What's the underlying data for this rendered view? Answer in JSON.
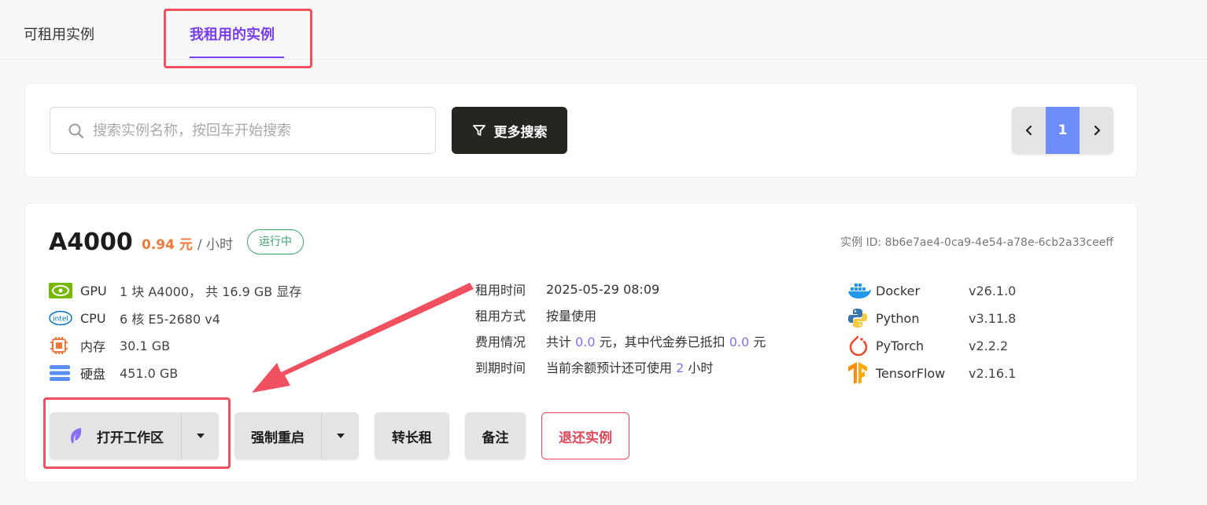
{
  "tabs": [
    {
      "label": "可租用实例",
      "active": false
    },
    {
      "label": "我租用的实例",
      "active": true
    }
  ],
  "search": {
    "placeholder": "搜索实例名称，按回车开始搜索",
    "value": "",
    "more_label": "更多搜索"
  },
  "pagination": {
    "prev_icon": "chevron-left-icon",
    "current": "1",
    "next_icon": "chevron-right-icon"
  },
  "instance": {
    "gpu": "A4000",
    "price": "0.94 元",
    "per": "/ 小时",
    "status": "运行中",
    "id_text": "实例 ID: 8b6e7ae4-0ca9-4e54-a78e-6cb2a33ceeff",
    "specs": [
      {
        "icon": "nvidia-icon",
        "label": "GPU",
        "value": "1 块 A4000， 共 16.9 GB 显存"
      },
      {
        "icon": "intel-icon",
        "label": "CPU",
        "value": "6 核 E5-2680 v4"
      },
      {
        "icon": "memory-chip-icon",
        "label": "内存",
        "value": "30.1 GB"
      },
      {
        "icon": "disk-icon",
        "label": "硬盘",
        "value": "451.0 GB"
      }
    ],
    "info": {
      "rent_time_label": "租用时间",
      "rent_time": "2025-05-29 08:09",
      "rent_mode_label": "租用方式",
      "rent_mode": "按量使用",
      "cost_label": "费用情况",
      "cost_prefix": "共计",
      "cost_total": "0.0",
      "cost_mid": "元，其中代金券已抵扣",
      "cost_voucher": "0.0",
      "cost_suffix": "元",
      "expire_label": "到期时间",
      "expire_prefix": "当前余额预计还可使用",
      "expire_hours": "2",
      "expire_suffix": "小时"
    },
    "software": [
      {
        "icon": "docker-icon",
        "name": "Docker",
        "version": "v26.1.0"
      },
      {
        "icon": "python-icon",
        "name": "Python",
        "version": "v3.11.8"
      },
      {
        "icon": "pytorch-icon",
        "name": "PyTorch",
        "version": "v2.2.2"
      },
      {
        "icon": "tensorflow-icon",
        "name": "TensorFlow",
        "version": "v2.16.1"
      }
    ],
    "buttons": {
      "open_workspace": "打开工作区",
      "force_restart": "强制重启",
      "long_term": "转长租",
      "note": "备注",
      "return": "退还实例"
    }
  },
  "colors": {
    "accent": "#7a3df0",
    "price": "#f07a3c",
    "status": "#3ca36a",
    "danger": "#e0485a",
    "annotation": "#f0505f"
  }
}
